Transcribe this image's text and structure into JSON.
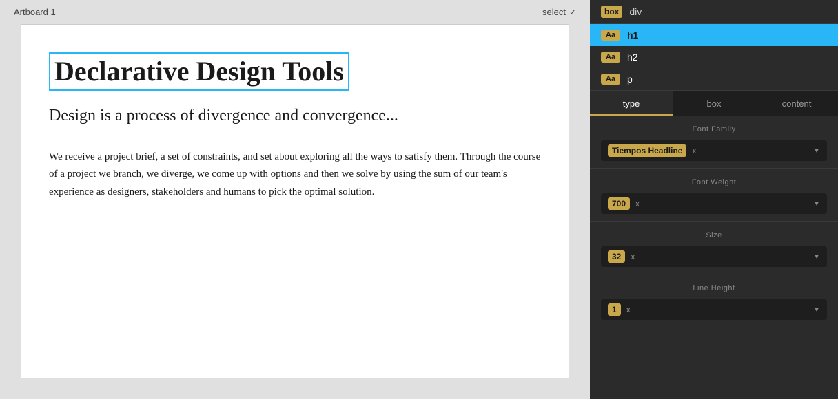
{
  "canvas": {
    "artboard_label": "Artboard 1",
    "select_label": "select",
    "h1_text": "Declarative Design Tools",
    "h2_text": "Design is a process of divergence and convergence...",
    "p_text": "We receive a project brief, a set of constraints, and set about exploring all the ways to satisfy them. Through the course of a project we branch, we diverge, we come up with options and then we solve by using the sum of our team's experience as designers, stakeholders and humans to pick the optimal solution."
  },
  "right_panel": {
    "div_badge": "box",
    "div_label": "div",
    "elements": [
      {
        "badge": "Aa",
        "label": "h1",
        "active": true
      },
      {
        "badge": "Aa",
        "label": "h2",
        "active": false
      },
      {
        "badge": "Aa",
        "label": "p",
        "active": false
      }
    ],
    "tabs": [
      {
        "label": "type",
        "active": true
      },
      {
        "label": "box",
        "active": false
      },
      {
        "label": "content",
        "active": false
      }
    ],
    "properties": {
      "font_family_label": "Font Family",
      "font_family_value": "Tiempos Headline",
      "font_family_x": "x",
      "font_weight_label": "Font Weight",
      "font_weight_value": "700",
      "font_weight_x": "x",
      "size_label": "Size",
      "size_value": "32",
      "size_x": "x",
      "line_height_label": "Line Height",
      "line_height_value": "1"
    }
  }
}
